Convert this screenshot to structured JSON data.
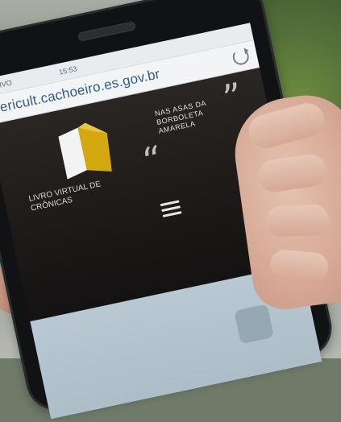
{
  "photo": {
    "status_bar": {
      "carrier": "● VIVO",
      "time": "15:53"
    },
    "address_bar": {
      "url": "sericult.cachoeiro.es.gov.br"
    },
    "site": {
      "logo_text": "LIVRO VIRTUAL DE CRÔNICAS",
      "slogan": "NAS ASAS DA BORBOLETA AMARELA",
      "quote_open": "“",
      "quote_close": "”"
    },
    "icons": [
      "reload-icon",
      "menu-icon",
      "book-logo-icon"
    ],
    "colors": {
      "logo_yellow": "#d4a90f",
      "logo_white": "#f3f3f3",
      "url_blue": "#2f5f8a"
    }
  }
}
